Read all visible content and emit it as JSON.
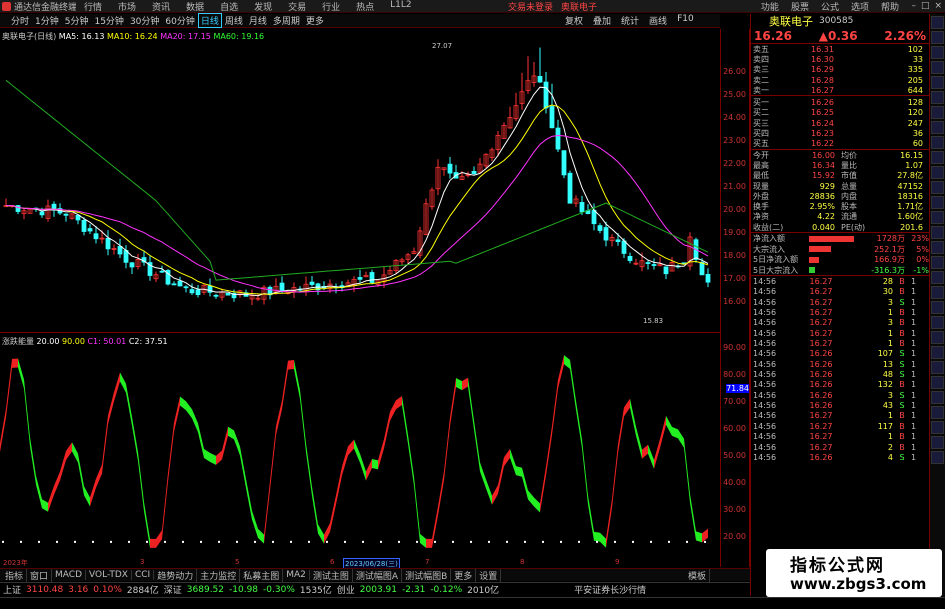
{
  "titlebar": {
    "app": "通达信金融终端",
    "menus": [
      "行情",
      "市场",
      "资讯",
      "数据",
      "自选",
      "发现",
      "交易",
      "行业",
      "热点",
      "L1L2"
    ],
    "center": [
      "交易未登录",
      "奥联电子"
    ],
    "right": [
      "功能",
      "股票",
      "公式",
      "选项",
      "帮助"
    ]
  },
  "toolbar": {
    "periods": [
      "分时",
      "1分钟",
      "5分钟",
      "15分钟",
      "30分钟",
      "60分钟",
      "日线",
      "周线",
      "月线",
      "多周期",
      "更多"
    ],
    "active": "日线",
    "right": [
      "复权",
      "叠加",
      "统计",
      "画线",
      "F10"
    ]
  },
  "main": {
    "stock": "奥联电子(日线)",
    "ma5": "MA5: 16.13",
    "ma10": "MA10: 16.24",
    "ma20": "MA20: 17.15",
    "ma60": "MA60: 19.16",
    "high_mark": "27.07",
    "low_mark": "15.83"
  },
  "sub": {
    "name": "涨跌能量",
    "v1": "20.00",
    "v2": "90.00",
    "v3": "C1: 50.01",
    "v4": "C2: 37.51",
    "axis_mark": "71.84"
  },
  "price_axis": [
    "26.00",
    "25.00",
    "24.00",
    "23.00",
    "22.00",
    "21.00",
    "20.00",
    "19.00",
    "18.00",
    "17.00",
    "16.00"
  ],
  "sub_axis": [
    "90.00",
    "80.00",
    "70.00",
    "60.00",
    "50.00",
    "40.00",
    "30.00",
    "20.00"
  ],
  "dates": {
    "left": "2023年",
    "mid": "2023/06/28(三)",
    "nums": [
      "3",
      "5",
      "6",
      "7",
      "8",
      "9"
    ]
  },
  "bottom_tabs": [
    "指标",
    "窗口",
    "MACD",
    "VOL-TDX",
    "CCI",
    "趋势动力",
    "主力监控",
    "私募主图",
    "MA2",
    "测试主图",
    "测试幅图A",
    "测试幅图B",
    "更多",
    "设置"
  ],
  "bottom_right": "模板",
  "index": [
    {
      "n": "上证",
      "v": "3110.48",
      "c": "3.16",
      "p": "0.10%",
      "a": "2884亿",
      "col": "#f44"
    },
    {
      "n": "深证",
      "v": "3689.52",
      "c": "-10.98",
      "p": "-0.30%",
      "a": "1535亿",
      "col": "#4f4"
    },
    {
      "n": "创业",
      "v": "2003.91",
      "c": "-2.31",
      "p": "-0.12%",
      "a": "2010亿",
      "col": "#4f4"
    }
  ],
  "index_tail": "平安证券长沙行情",
  "panel": {
    "name": "奥联电子",
    "code": "300585",
    "price": "16.26",
    "change": "0.36",
    "pct": "2.26%",
    "sell": [
      [
        "卖五",
        "16.31",
        "102"
      ],
      [
        "卖四",
        "16.30",
        "33"
      ],
      [
        "卖三",
        "16.29",
        "335"
      ],
      [
        "卖二",
        "16.28",
        "205"
      ],
      [
        "卖一",
        "16.27",
        "644"
      ]
    ],
    "buy": [
      [
        "买一",
        "16.26",
        "128"
      ],
      [
        "买二",
        "16.25",
        "120"
      ],
      [
        "买三",
        "16.24",
        "247"
      ],
      [
        "买四",
        "16.23",
        "36"
      ],
      [
        "买五",
        "16.22",
        "60"
      ]
    ],
    "stats": [
      [
        "今开",
        "16.00",
        "均价",
        "16.15"
      ],
      [
        "最高",
        "16.34",
        "量比",
        "1.07"
      ],
      [
        "最低",
        "15.92",
        "市值",
        "27.8亿"
      ],
      [
        "现量",
        "929",
        "总量",
        "47152"
      ],
      [
        "外盘",
        "28836",
        "内盘",
        "18316"
      ],
      [
        "换手",
        "2.95%",
        "股本",
        "1.71亿"
      ],
      [
        "净资",
        "4.22",
        "流通",
        "1.60亿"
      ],
      [
        "收益(二)",
        "0.040",
        "PE(动)",
        "201.6"
      ]
    ],
    "flow": [
      [
        "净流入额",
        "1728万",
        "23%"
      ],
      [
        "大宗流入",
        "252.1万",
        "5%"
      ],
      [
        "5日净流入额",
        "166.9万",
        "0%"
      ],
      [
        "5日大宗流入",
        "-316.3万",
        "-1%"
      ]
    ],
    "ticks": [
      [
        "14:56",
        "16.27",
        "28",
        "B",
        "1"
      ],
      [
        "14:56",
        "16.27",
        "30",
        "B",
        "1"
      ],
      [
        "14:56",
        "16.27",
        "3",
        "S",
        "1"
      ],
      [
        "14:56",
        "16.27",
        "1",
        "B",
        "1"
      ],
      [
        "14:56",
        "16.27",
        "3",
        "B",
        "1"
      ],
      [
        "14:56",
        "16.27",
        "1",
        "B",
        "1"
      ],
      [
        "14:56",
        "16.27",
        "1",
        "B",
        "1"
      ],
      [
        "14:56",
        "16.26",
        "107",
        "S",
        "1"
      ],
      [
        "14:56",
        "16.26",
        "13",
        "S",
        "1"
      ],
      [
        "14:56",
        "16.26",
        "48",
        "S",
        "1"
      ],
      [
        "14:56",
        "16.26",
        "132",
        "B",
        "1"
      ],
      [
        "14:56",
        "16.26",
        "3",
        "S",
        "1"
      ],
      [
        "14:56",
        "16.26",
        "43",
        "S",
        "1"
      ],
      [
        "14:56",
        "16.27",
        "1",
        "B",
        "1"
      ],
      [
        "14:56",
        "16.27",
        "117",
        "B",
        "1"
      ],
      [
        "14:56",
        "16.27",
        "1",
        "B",
        "1"
      ],
      [
        "14:56",
        "16.27",
        "2",
        "B",
        "1"
      ],
      [
        "14:56",
        "16.26",
        "4",
        "S",
        "1"
      ]
    ]
  },
  "watermark": {
    "title": "指标公式网",
    "url": "www.zbgs3.com"
  }
}
